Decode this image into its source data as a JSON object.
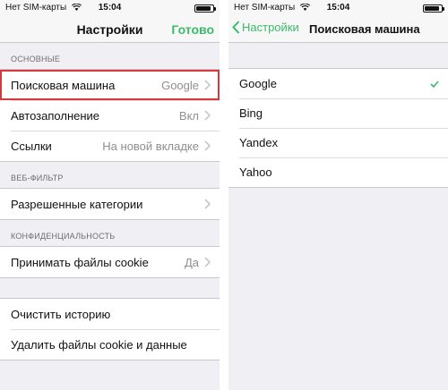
{
  "colors": {
    "accent": "#3bba6a",
    "highlight": "#d9363e",
    "background": "#efeff4"
  },
  "left": {
    "status": {
      "carrier": "Нет SIM-карты",
      "time": "15:04",
      "battery_level": 0.9
    },
    "nav": {
      "title": "Настройки",
      "done": "Готово"
    },
    "sections": {
      "basic": {
        "header": "ОСНОВНЫЕ",
        "search_engine": {
          "label": "Поисковая машина",
          "value": "Google"
        },
        "autofill": {
          "label": "Автозаполнение",
          "value": "Вкл"
        },
        "links": {
          "label": "Ссылки",
          "value": "На новой вкладке"
        }
      },
      "web_filter": {
        "header": "ВЕБ-ФИЛЬТР",
        "allowed_categories": {
          "label": "Разрешенные категории"
        }
      },
      "privacy": {
        "header": "КОНФИДЕНЦИАЛЬНОСТЬ",
        "accept_cookies": {
          "label": "Принимать файлы cookie",
          "value": "Да"
        }
      },
      "actions": {
        "clear_history": "Очистить историю",
        "delete_cookies": "Удалить файлы cookie и данные"
      }
    }
  },
  "right": {
    "status": {
      "carrier": "Нет SIM-карты",
      "time": "15:04",
      "battery_level": 0.9
    },
    "nav": {
      "back": "Настройки",
      "title": "Поисковая машина"
    },
    "engines": [
      {
        "name": "Google",
        "selected": true
      },
      {
        "name": "Bing",
        "selected": false
      },
      {
        "name": "Yandex",
        "selected": false
      },
      {
        "name": "Yahoo",
        "selected": false
      }
    ],
    "check_icon": "checkmark-icon"
  }
}
